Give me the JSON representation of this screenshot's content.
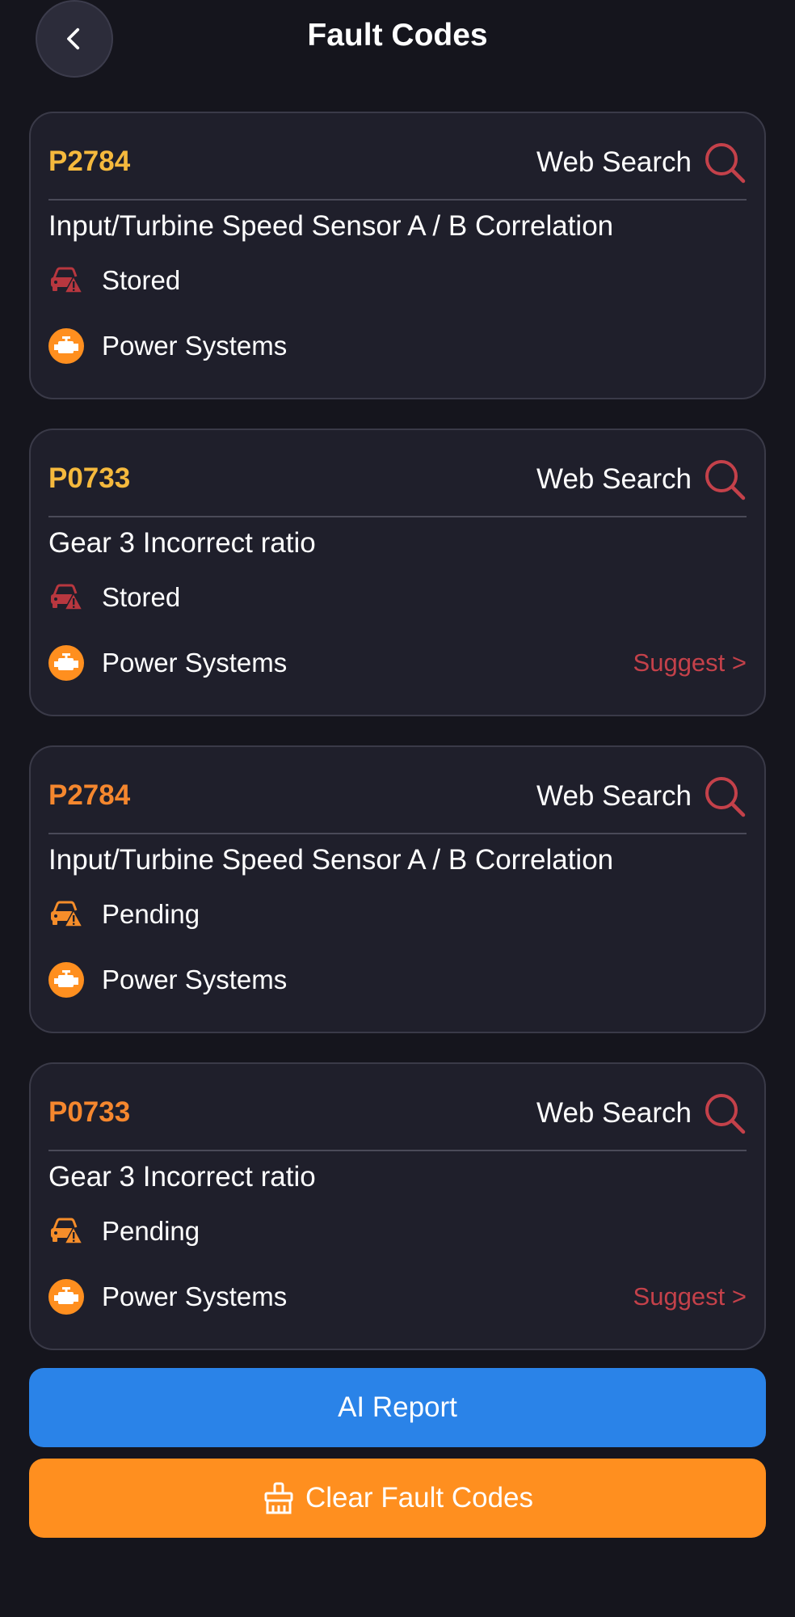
{
  "header": {
    "title": "Fault Codes",
    "back_icon": "chevron-left-icon"
  },
  "colors": {
    "background": "#15151d",
    "card": "#1f1f2b",
    "stored_code": "#f5b93d",
    "pending_code": "#f5872e",
    "stored_icon": "#b8373f",
    "pending_icon": "#f58d2a",
    "engine_icon": "#ff8f1f",
    "search_icon": "#c4414a",
    "suggest": "#c4414a",
    "ai_report": "#2a83e8",
    "clear": "#ff8f1f"
  },
  "cards": [
    {
      "code": "P2784",
      "web_search_label": "Web Search",
      "description": "Input/Turbine Speed Sensor A / B Correlation",
      "status": "Stored",
      "system": "Power Systems",
      "suggest": ""
    },
    {
      "code": "P0733",
      "web_search_label": "Web Search",
      "description": "Gear 3 Incorrect ratio",
      "status": "Stored",
      "system": "Power Systems",
      "suggest": "Suggest >"
    },
    {
      "code": "P2784",
      "web_search_label": "Web Search",
      "description": "Input/Turbine Speed Sensor A / B Correlation",
      "status": "Pending",
      "system": "Power Systems",
      "suggest": ""
    },
    {
      "code": "P0733",
      "web_search_label": "Web Search",
      "description": "Gear 3 Incorrect ratio",
      "status": "Pending",
      "system": "Power Systems",
      "suggest": "Suggest >"
    }
  ],
  "buttons": {
    "ai_report": "AI Report",
    "clear_fault_codes": "Clear Fault Codes",
    "clear_icon": "broom-icon"
  }
}
